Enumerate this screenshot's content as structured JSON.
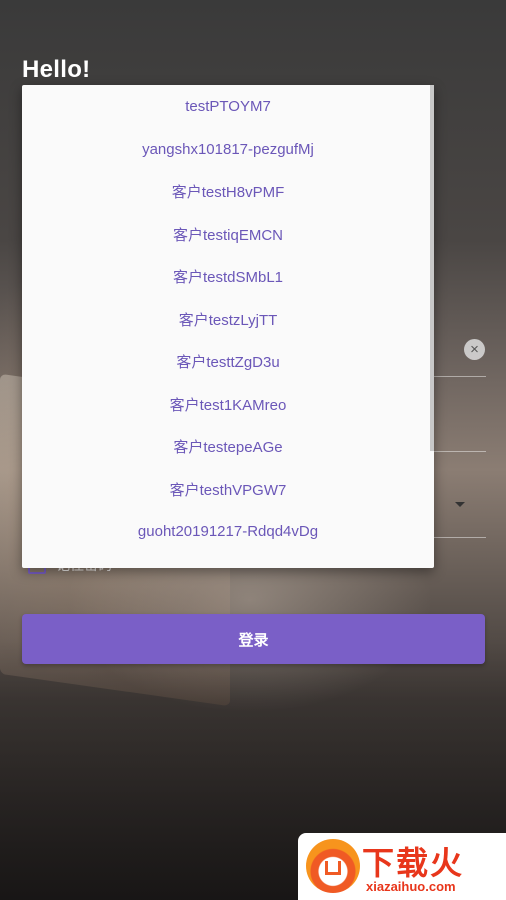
{
  "header": {
    "greeting": "Hello!"
  },
  "form": {
    "clear_icon": "close-circle-icon",
    "remember_label": "记住密码",
    "login_label": "登录"
  },
  "dropdown": {
    "items": [
      "testPTOYM7",
      "yangshx101817-pezgufMj",
      "客户testH8vPMF",
      "客户testiqEMCN",
      "客户testdSMbL1",
      "客户testzLyjTT",
      "客户testtZgD3u",
      "客户test1KAMreo",
      "客户testepeAGe",
      "客户testhVPGW7",
      "guoht20191217-Rdqd4vDg"
    ]
  },
  "watermark": {
    "title": "下载火",
    "url": "xiazaihuo.com"
  },
  "colors": {
    "accent": "#7a5fc7",
    "item_text": "#6b57b8",
    "watermark": "#e8361b"
  }
}
